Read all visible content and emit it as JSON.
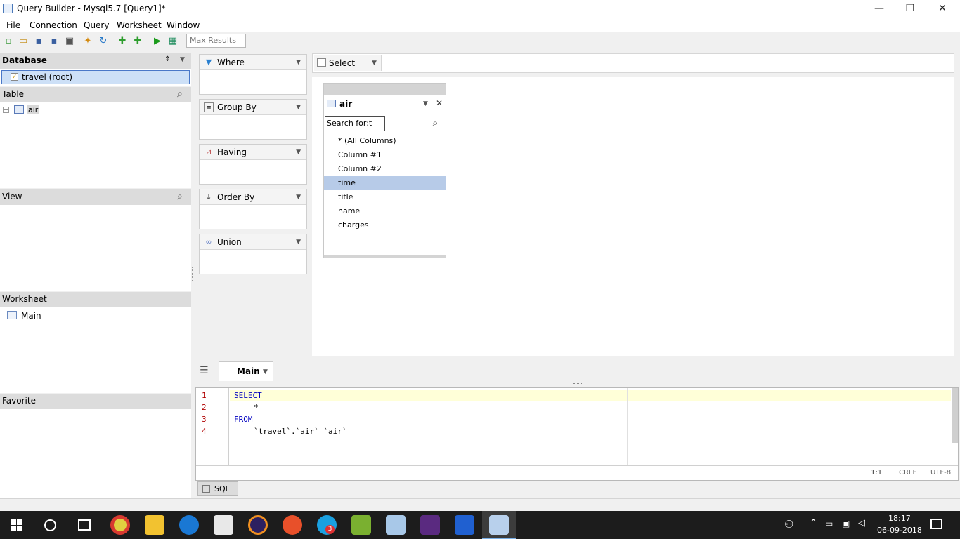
{
  "window": {
    "title": "Query Builder - Mysql5.7 [Query1]*",
    "minimize": "—",
    "restore": "❐",
    "close": "✕"
  },
  "menu": [
    "File",
    "Connection",
    "Query",
    "Worksheet",
    "Window"
  ],
  "toolbar": {
    "max_results_placeholder": "Max Results"
  },
  "left": {
    "database_header": "Database",
    "database_item": "travel (root)",
    "table_header": "Table",
    "table_item": "air",
    "view_header": "View",
    "worksheet_header": "Worksheet",
    "worksheet_item": "Main",
    "favorite_header": "Favorite"
  },
  "clauses": [
    {
      "label": "Where",
      "icon": "filter-icon"
    },
    {
      "label": "Group By",
      "icon": "group-icon"
    },
    {
      "label": "Having",
      "icon": "having-icon"
    },
    {
      "label": "Order By",
      "icon": "sort-icon"
    },
    {
      "label": "Union",
      "icon": "union-icon"
    }
  ],
  "select_tab": {
    "label": "Select"
  },
  "table_box": {
    "name": "air",
    "search_value": "Search for:t",
    "columns": [
      "* (All Columns)",
      "Column #1",
      "Column #2",
      "time",
      "title",
      "name",
      "charges"
    ],
    "selected_column": "time"
  },
  "bottom_tab": {
    "label": "Main"
  },
  "editor": {
    "line_numbers": [
      "1",
      "2",
      "3",
      "4"
    ],
    "lines": [
      "SELECT",
      "*",
      "FROM",
      "`travel`.`air` `air`"
    ],
    "status_position": "1:1",
    "status_eol": "CRLF",
    "status_encoding": "UTF-8"
  },
  "sql_tab": {
    "label": "SQL"
  },
  "taskbar": {
    "time": "18:17",
    "date": "06-09-2018",
    "skype_badge": "3"
  },
  "colors": {
    "selection": "#b7cbe8",
    "keyword": "#0000c0",
    "line_number": "#b00000",
    "taskbar": "#1c1c1c"
  }
}
